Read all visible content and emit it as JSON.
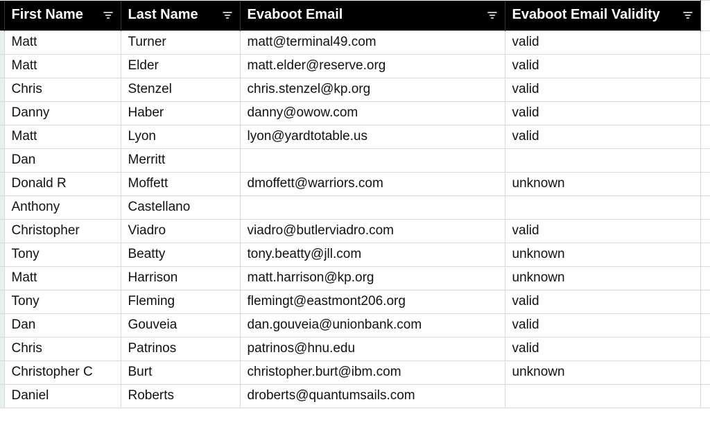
{
  "columns": [
    {
      "key": "first",
      "label": "First Name",
      "filter": true
    },
    {
      "key": "last",
      "label": "Last Name",
      "filter": true
    },
    {
      "key": "email",
      "label": "Evaboot Email",
      "filter": true
    },
    {
      "key": "valid",
      "label": "Evaboot Email Validity",
      "filter": true
    }
  ],
  "rows": [
    {
      "first": "Matt",
      "last": "Turner",
      "email": "matt@terminal49.com",
      "valid": "valid"
    },
    {
      "first": "Matt",
      "last": "Elder",
      "email": "matt.elder@reserve.org",
      "valid": "valid"
    },
    {
      "first": "Chris",
      "last": "Stenzel",
      "email": "chris.stenzel@kp.org",
      "valid": "valid"
    },
    {
      "first": "Danny",
      "last": "Haber",
      "email": "danny@owow.com",
      "valid": "valid"
    },
    {
      "first": "Matt",
      "last": "Lyon",
      "email": "lyon@yardtotable.us",
      "valid": "valid"
    },
    {
      "first": "Dan",
      "last": "Merritt",
      "email": "",
      "valid": ""
    },
    {
      "first": "Donald R",
      "last": "Moffett",
      "email": "dmoffett@warriors.com",
      "valid": "unknown"
    },
    {
      "first": "Anthony",
      "last": "Castellano",
      "email": "",
      "valid": ""
    },
    {
      "first": "Christopher",
      "last": "Viadro",
      "email": "viadro@butlerviadro.com",
      "valid": "valid"
    },
    {
      "first": "Tony",
      "last": "Beatty",
      "email": "tony.beatty@jll.com",
      "valid": "unknown"
    },
    {
      "first": "Matt",
      "last": "Harrison",
      "email": "matt.harrison@kp.org",
      "valid": "unknown"
    },
    {
      "first": "Tony",
      "last": "Fleming",
      "email": "flemingt@eastmont206.org",
      "valid": "valid"
    },
    {
      "first": "Dan",
      "last": "Gouveia",
      "email": "dan.gouveia@unionbank.com",
      "valid": "valid"
    },
    {
      "first": "Chris",
      "last": "Patrinos",
      "email": "patrinos@hnu.edu",
      "valid": "valid"
    },
    {
      "first": "Christopher C",
      "last": "Burt",
      "email": "christopher.burt@ibm.com",
      "valid": "unknown"
    },
    {
      "first": "Daniel",
      "last": "Roberts",
      "email": "droberts@quantumsails.com",
      "valid": ""
    }
  ]
}
